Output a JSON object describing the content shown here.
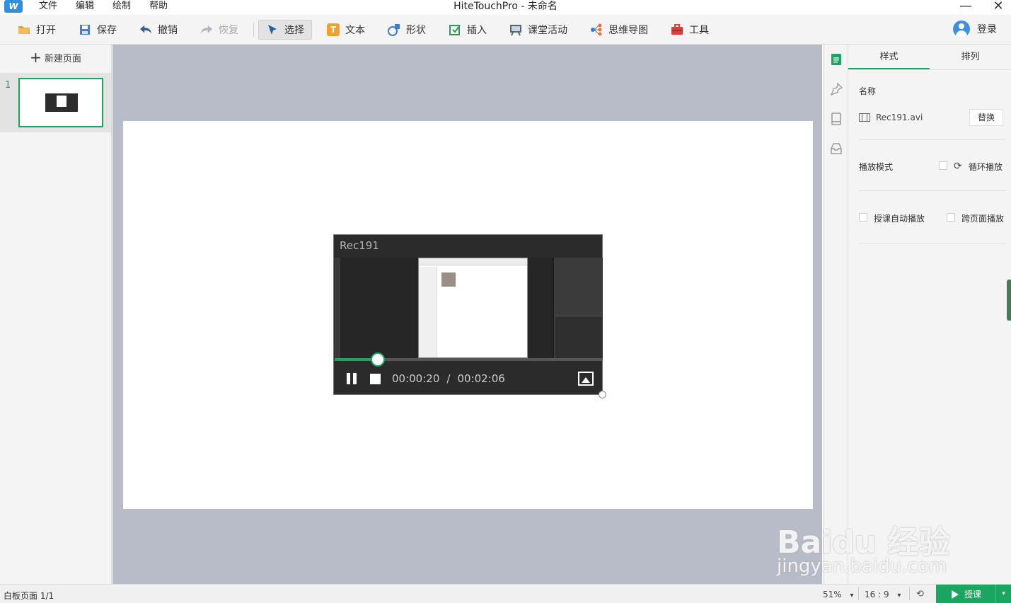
{
  "window": {
    "title": "HiteTouchPro - 未命名",
    "logo": "W",
    "minimize": "—",
    "close": "✕"
  },
  "menu": [
    "文件",
    "编辑",
    "绘制",
    "帮助"
  ],
  "toolbar": {
    "open": "打开",
    "save": "保存",
    "undo": "撤销",
    "redo": "恢复",
    "select": "选择",
    "text": "文本",
    "shape": "形状",
    "insert": "插入",
    "activity": "课堂活动",
    "mindmap": "思维导图",
    "tools": "工具",
    "login": "登录",
    "text_icon": "T"
  },
  "pages": {
    "new_page": "新建页面",
    "new_page_icon": "+",
    "items": [
      {
        "number": "1"
      }
    ]
  },
  "video": {
    "title": "Rec191",
    "current_time": "00:00:20",
    "separator": "/",
    "total_time": "00:02:06",
    "progress": 0.16
  },
  "props": {
    "tabs": [
      "样式",
      "排列"
    ],
    "name_label": "名称",
    "file_name": "Rec191.avi",
    "replace": "替换",
    "play_mode_label": "播放模式",
    "loop": "循环播放",
    "loop_icon": "⟳",
    "auto_play": "授课自动播放",
    "cross_page": "跨页面播放"
  },
  "status": {
    "page_info": "白板页面 1/1",
    "zoom": "51%",
    "zoom_caret": "▾",
    "ratio": "16 : 9",
    "ratio_caret": "▾",
    "sync_icon": "⟲",
    "start": "授课",
    "start_caret": "▾"
  },
  "watermark": {
    "main": "Baidu 经验",
    "sub": "jingyan.baidu.com"
  },
  "colors": {
    "accent": "#1aa560",
    "canvas_bg": "#b8bcc9",
    "toolbar_bg": "#f4f4f4"
  }
}
